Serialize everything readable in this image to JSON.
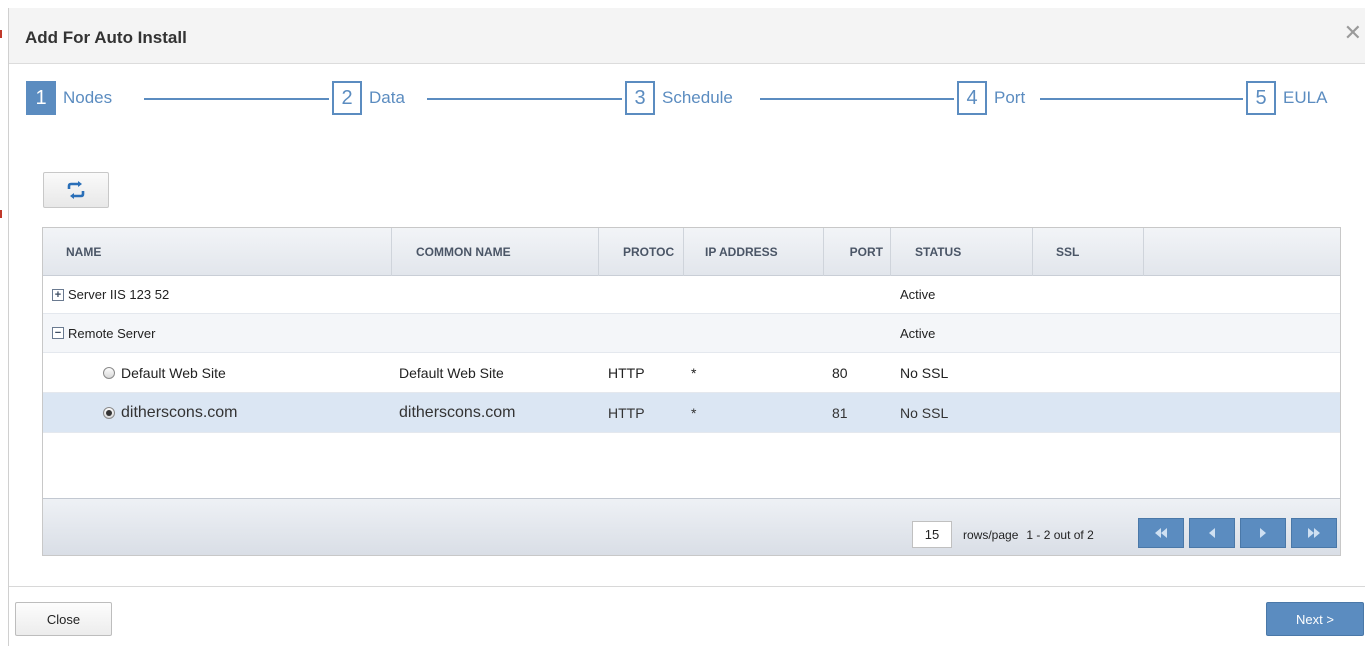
{
  "dialog": {
    "title": "Add For Auto Install",
    "close_glyph": "✕"
  },
  "stepper": {
    "active_step": 1,
    "steps": [
      {
        "num": "1",
        "label": "Nodes"
      },
      {
        "num": "2",
        "label": "Data"
      },
      {
        "num": "3",
        "label": "Schedule"
      },
      {
        "num": "4",
        "label": "Port"
      },
      {
        "num": "5",
        "label": "EULA"
      }
    ]
  },
  "toolbar": {
    "refresh_icon": "refresh-icon"
  },
  "grid": {
    "columns": [
      "NAME",
      "COMMON NAME",
      "PROTOC",
      "IP ADDRESS",
      "PORT",
      "STATUS",
      "SSL"
    ],
    "rows": [
      {
        "kind": "group",
        "expand": "+",
        "name": "Server IIS 123 52",
        "status": "Active"
      },
      {
        "kind": "group",
        "expand": "−",
        "name": "Remote Server",
        "status": "Active"
      },
      {
        "kind": "item",
        "selected": false,
        "name": "Default Web Site",
        "common_name": "Default Web Site",
        "protocol": "HTTP",
        "ip": "*",
        "port": "80",
        "status": "No SSL"
      },
      {
        "kind": "item",
        "selected": true,
        "name": "ditherscons.com",
        "common_name": "ditherscons.com",
        "protocol": "HTTP",
        "ip": "*",
        "port": "81",
        "status": "No SSL"
      }
    ]
  },
  "pager": {
    "rows_per_page": "15",
    "rows_label": "rows/page",
    "range_text": "1 - 2 out of 2"
  },
  "footer": {
    "close_label": "Close",
    "next_label": "Next >"
  },
  "colors": {
    "accent": "#5b8cc0",
    "selected_row": "#dbe6f3"
  }
}
